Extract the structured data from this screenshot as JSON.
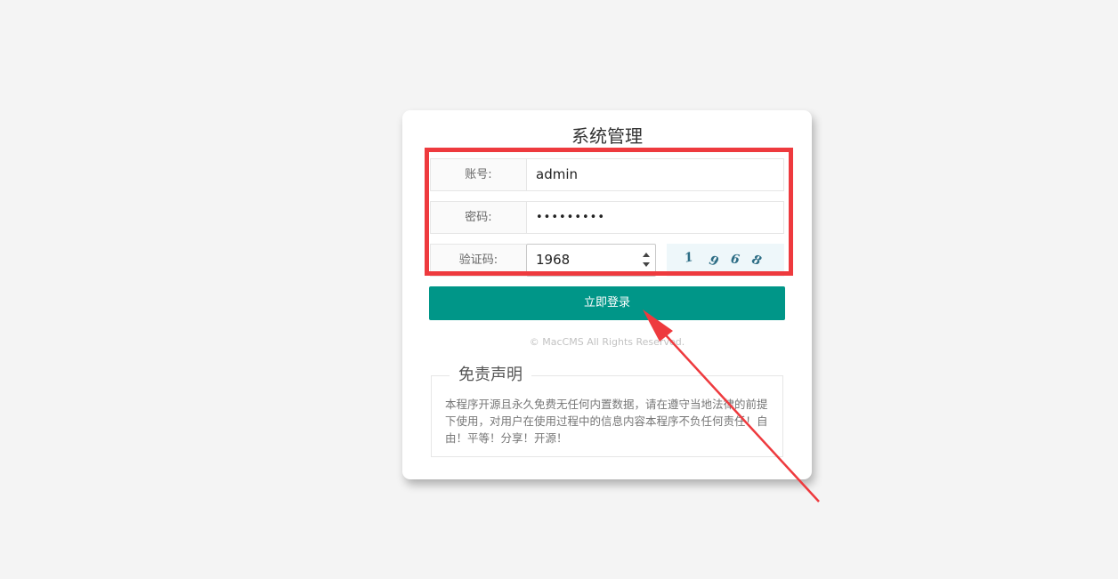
{
  "card": {
    "title": "系统管理"
  },
  "form": {
    "account_label": "账号:",
    "account_value": "admin",
    "password_label": "密码:",
    "password_value": "•••••••••",
    "captcha_label": "验证码:",
    "captcha_value": "1968",
    "captcha_image_chars": [
      "1",
      "9",
      "6",
      "8"
    ]
  },
  "login_button": {
    "label": "立即登录"
  },
  "footer": {
    "copyright": "© MacCMS All Rights Reserved."
  },
  "disclaimer": {
    "title": "免责声明",
    "text": "本程序开源且永久免费无任何内置数据，请在遵守当地法律的前提下使用，对用户在使用过程中的信息内容本程序不负任何责任！自由！平等！分享！开源！"
  },
  "colors": {
    "accent": "#009688",
    "annotation": "#ee3a3e",
    "background": "#f4f4f4"
  }
}
